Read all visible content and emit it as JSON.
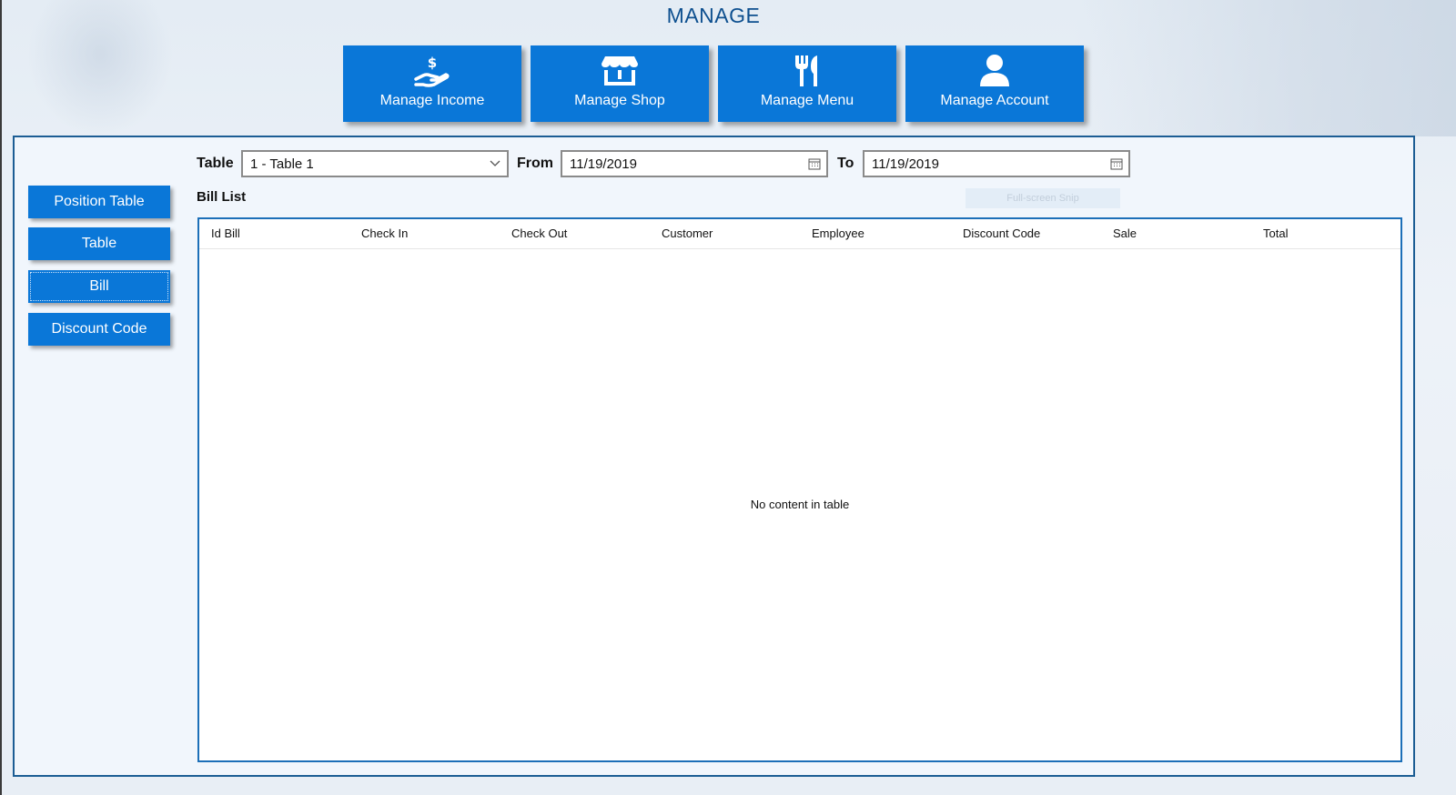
{
  "header": {
    "title": "MANAGE"
  },
  "nav": [
    {
      "label": "Manage Income",
      "icon": "income-hand-dollar-icon"
    },
    {
      "label": "Manage Shop",
      "icon": "shop-icon"
    },
    {
      "label": "Manage Menu",
      "icon": "fork-knife-icon"
    },
    {
      "label": "Manage Account",
      "icon": "user-icon"
    }
  ],
  "sidebar": {
    "items": [
      {
        "label": "Position Table"
      },
      {
        "label": "Table"
      },
      {
        "label": "Bill",
        "active": true
      },
      {
        "label": "Discount Code"
      }
    ]
  },
  "filters": {
    "table_label": "Table",
    "table_value": "1 - Table 1",
    "from_label": "From",
    "from_value": "11/19/2019",
    "to_label": "To",
    "to_value": "11/19/2019"
  },
  "bill_list": {
    "title": "Bill List",
    "ghost_button": "Full-screen Snip",
    "columns": [
      "Id Bill",
      "Check In",
      "Check Out",
      "Customer",
      "Employee",
      "Discount Code",
      "Sale",
      "Total"
    ],
    "rows": [],
    "empty_message": "No content in table"
  },
  "colors": {
    "accent": "#0a77d8",
    "title": "#0d4f8f",
    "panel_border": "#1c5d94"
  }
}
